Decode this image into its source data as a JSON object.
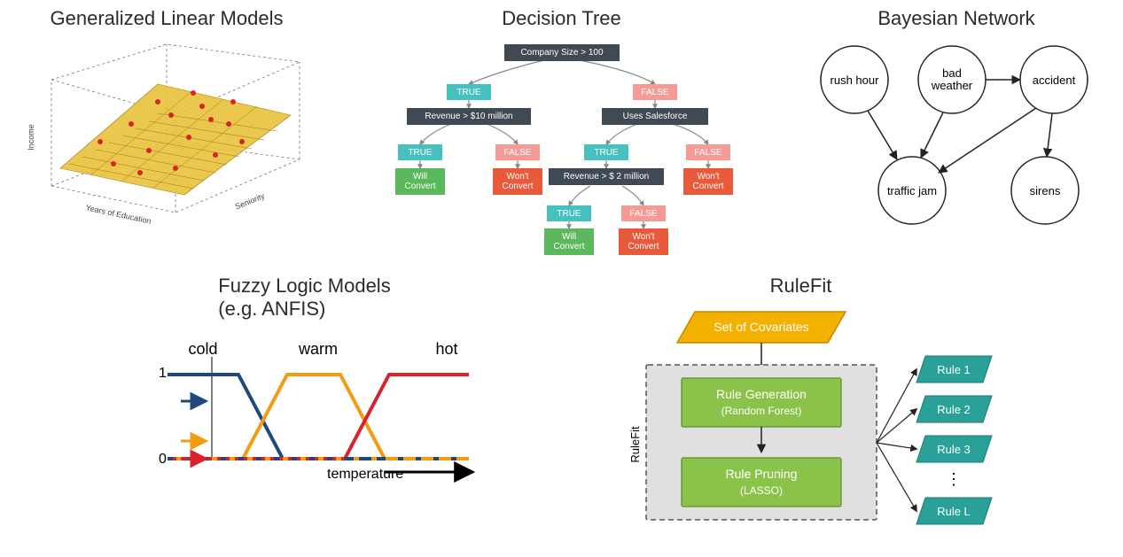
{
  "glm": {
    "title": "Generalized Linear Models",
    "axes": {
      "y": "Income",
      "x1": "Years of Education",
      "x2": "Seniority"
    }
  },
  "dtree": {
    "title": "Decision Tree",
    "nodes": {
      "root": "Company Size > 100",
      "left1": "Revenue > $10 million",
      "right1": "Uses Salesforce",
      "right2": "Revenue > $ 2 million",
      "true_label": "TRUE",
      "false_label": "FALSE",
      "will": "Will\nConvert",
      "wont": "Won't\nConvert"
    }
  },
  "bn": {
    "title": "Bayesian Network",
    "nodes": [
      "rush hour",
      "bad weather",
      "accident",
      "traffic jam",
      "sirens"
    ],
    "edges": [
      [
        "rush hour",
        "traffic jam"
      ],
      [
        "bad weather",
        "traffic jam"
      ],
      [
        "bad weather",
        "accident"
      ],
      [
        "accident",
        "traffic jam"
      ],
      [
        "accident",
        "sirens"
      ]
    ]
  },
  "fuzzy": {
    "title": "Fuzzy Logic Models",
    "subtitle": "(e.g. ANFIS)",
    "labels": {
      "cold": "cold",
      "warm": "warm",
      "hot": "hot",
      "xaxis": "temperature",
      "y0": "0",
      "y1": "1"
    }
  },
  "rulefit": {
    "title": "RuleFit",
    "input": "Set of Covariates",
    "box1_line1": "Rule Generation",
    "box1_line2": "(Random Forest)",
    "box2_line1": "Rule Pruning",
    "box2_line2": "(LASSO)",
    "side_label": "RuleFit",
    "rules": [
      "Rule 1",
      "Rule 2",
      "Rule 3",
      "Rule L"
    ],
    "dots": "⋮"
  },
  "chart_data": {
    "type": "diagram-collection",
    "panels": [
      {
        "name": "Generalized Linear Models",
        "type": "3d-scatter-plane",
        "axes": [
          "Years of Education",
          "Seniority",
          "Income"
        ],
        "description": "3D regression plane (yellow grid) fit to red scatter points"
      },
      {
        "name": "Decision Tree",
        "type": "tree",
        "root": "Company Size > 100",
        "children": [
          {
            "branch": "TRUE",
            "test": "Revenue > $10 million",
            "children": [
              {
                "branch": "TRUE",
                "leaf": "Will Convert"
              },
              {
                "branch": "FALSE",
                "leaf": "Won't Convert"
              }
            ]
          },
          {
            "branch": "FALSE",
            "test": "Uses Salesforce",
            "children": [
              {
                "branch": "TRUE",
                "test": "Revenue > $ 2 million",
                "children": [
                  {
                    "branch": "TRUE",
                    "leaf": "Will Convert"
                  },
                  {
                    "branch": "FALSE",
                    "leaf": "Won't Convert"
                  }
                ]
              },
              {
                "branch": "FALSE",
                "leaf": "Won't Convert"
              }
            ]
          }
        ]
      },
      {
        "name": "Bayesian Network",
        "type": "dag",
        "nodes": [
          "rush hour",
          "bad weather",
          "accident",
          "traffic jam",
          "sirens"
        ],
        "edges": [
          [
            "rush hour",
            "traffic jam"
          ],
          [
            "bad weather",
            "traffic jam"
          ],
          [
            "bad weather",
            "accident"
          ],
          [
            "accident",
            "traffic jam"
          ],
          [
            "accident",
            "sirens"
          ]
        ]
      },
      {
        "name": "Fuzzy Logic Models (e.g. ANFIS)",
        "type": "line",
        "xlabel": "temperature",
        "ylim": [
          0,
          1
        ],
        "series": [
          {
            "name": "cold",
            "color": "#1f497d",
            "points": [
              [
                0,
                1
              ],
              [
                0.25,
                1
              ],
              [
                0.4,
                0
              ],
              [
                1,
                0
              ]
            ]
          },
          {
            "name": "warm",
            "color": "#f39c12",
            "points": [
              [
                0,
                0
              ],
              [
                0.28,
                0
              ],
              [
                0.42,
                1
              ],
              [
                0.58,
                1
              ],
              [
                0.73,
                0
              ],
              [
                1,
                0
              ]
            ]
          },
          {
            "name": "hot",
            "color": "#e11",
            "points": [
              [
                0,
                0
              ],
              [
                0.6,
                0
              ],
              [
                0.75,
                1
              ],
              [
                1,
                1
              ]
            ]
          }
        ]
      },
      {
        "name": "RuleFit",
        "type": "flowchart",
        "steps": [
          "Set of Covariates",
          "Rule Generation (Random Forest)",
          "Rule Pruning (LASSO)"
        ],
        "outputs": [
          "Rule 1",
          "Rule 2",
          "Rule 3",
          "…",
          "Rule L"
        ]
      }
    ]
  }
}
